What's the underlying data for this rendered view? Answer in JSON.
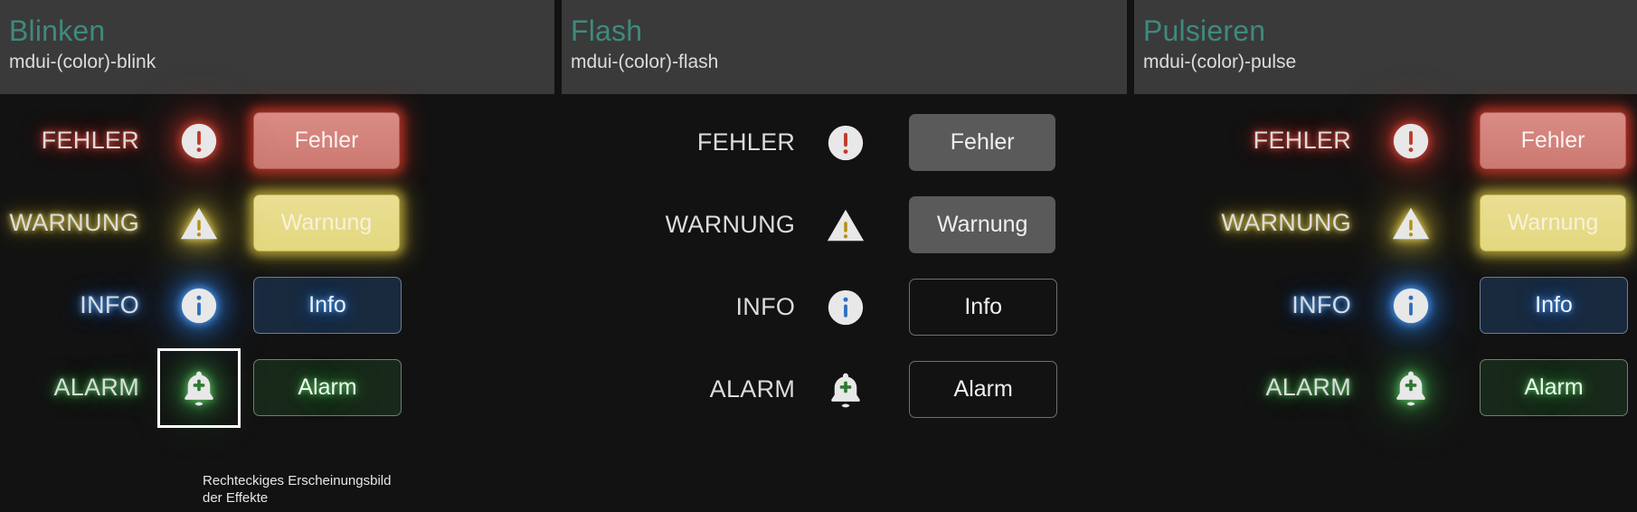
{
  "panels": [
    {
      "title": "Blinken",
      "subtitle": "mdui-(color)-blink",
      "style": "glow",
      "rows": [
        {
          "label": "FEHLER",
          "icon": "error-circle-icon",
          "button": "Fehler",
          "button_kind": "filled-error"
        },
        {
          "label": "WARNUNG",
          "icon": "warning-triangle-icon",
          "button": "Warnung",
          "button_kind": "filled-warning"
        },
        {
          "label": "INFO",
          "icon": "info-circle-icon",
          "button": "Info",
          "button_kind": "outlined-info"
        },
        {
          "label": "ALARM",
          "icon": "bell-plus-icon",
          "button": "Alarm",
          "button_kind": "outlined-alarm",
          "focused": true
        }
      ]
    },
    {
      "title": "Flash",
      "subtitle": "mdui-(color)-flash",
      "style": "plain",
      "rows": [
        {
          "label": "FEHLER",
          "icon": "error-circle-icon",
          "button": "Fehler",
          "button_kind": "flat-filled"
        },
        {
          "label": "WARNUNG",
          "icon": "warning-triangle-icon",
          "button": "Warnung",
          "button_kind": "flat-filled"
        },
        {
          "label": "INFO",
          "icon": "info-circle-icon",
          "button": "Info",
          "button_kind": "flat-outlined"
        },
        {
          "label": "ALARM",
          "icon": "bell-plus-icon",
          "button": "Alarm",
          "button_kind": "flat-outlined"
        }
      ]
    },
    {
      "title": "Pulsieren",
      "subtitle": "mdui-(color)-pulse",
      "style": "glow",
      "rows": [
        {
          "label": "FEHLER",
          "icon": "error-circle-icon",
          "button": "Fehler",
          "button_kind": "filled-error"
        },
        {
          "label": "WARNUNG",
          "icon": "warning-triangle-icon",
          "button": "Warnung",
          "button_kind": "filled-warning"
        },
        {
          "label": "INFO",
          "icon": "info-circle-icon",
          "button": "Info",
          "button_kind": "outlined-info"
        },
        {
          "label": "ALARM",
          "icon": "bell-plus-icon",
          "button": "Alarm",
          "button_kind": "outlined-alarm"
        }
      ]
    }
  ],
  "caption": "Rechteckiges Erscheinungsbild der Effekte",
  "colors": {
    "header_bg": "#3a3a3a",
    "body_bg": "#121212",
    "title": "#3f8a7d",
    "subtitle": "#dcdcdc",
    "error": "#e04a3f",
    "warning": "#e8d45c",
    "info": "#5da8ff",
    "alarm": "#63c46a",
    "focus_ring": "#ffffff",
    "flat_button": "#5a5a5a"
  }
}
